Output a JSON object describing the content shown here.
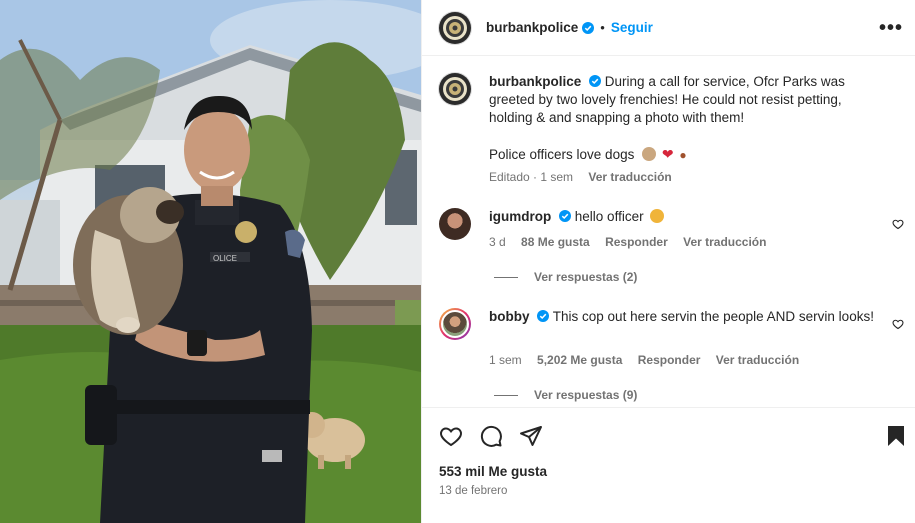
{
  "header": {
    "username": "burbankpolice",
    "separator": "•",
    "follow_label": "Seguir",
    "more_label": "•••"
  },
  "caption": {
    "username": "burbankpolice",
    "text": "During a call for service, Ofcr Parks was greeted by two lovely frenchies! He could not resist petting, holding & and snapping a photo with them!",
    "text2": "Police officers love dogs",
    "edited": "Editado · 1 sem",
    "translate": "Ver traducción"
  },
  "comments": [
    {
      "username": "igumdrop",
      "text": "hello officer",
      "time": "3 d",
      "likes": "88 Me gusta",
      "reply": "Responder",
      "translate": "Ver traducción",
      "view_replies": "Ver respuestas (2)"
    },
    {
      "username": "bobby",
      "text": "This cop out here servin the people AND servin looks!",
      "time": "1 sem",
      "likes": "5,202 Me gusta",
      "reply": "Responder",
      "translate": "Ver traducción",
      "view_replies": "Ver respuestas (9)"
    }
  ],
  "footer": {
    "likes": "553 mil Me gusta",
    "date": "13 de febrero"
  },
  "colors": {
    "accent": "#0095f6",
    "verified": "#0095f6",
    "text": "#262626",
    "muted": "#737373"
  },
  "icons": [
    "verified-badge-icon",
    "more-options-icon",
    "heart-icon",
    "comment-icon",
    "share-icon",
    "save-bookmark-icon"
  ]
}
